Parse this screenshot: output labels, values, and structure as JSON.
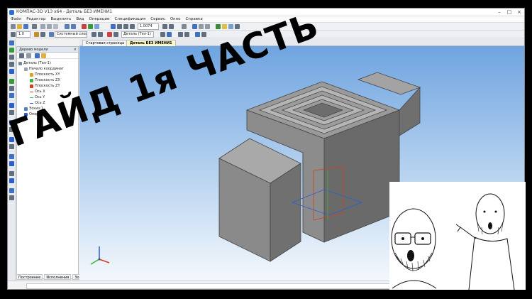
{
  "window": {
    "title": "КОМПАС-3D V13 x64 - Деталь БЕЗ ИМЕНИ1"
  },
  "menu": [
    "Файл",
    "Редактор",
    "Выделить",
    "Вид",
    "Операции",
    "Спецификация",
    "Сервис",
    "Окно",
    "Справка"
  ],
  "toolbar": {
    "scale_value": "1.0074",
    "step_value": "1.0",
    "layer_value": "Системный слой (0)",
    "part_value": "Деталь (Тел-1)"
  },
  "tree": {
    "header": "Дерево модели",
    "items": [
      {
        "label": "Деталь (Тел-1)",
        "color": "#7a8894"
      },
      {
        "label": "Начало координат",
        "color": "#9aa3ad"
      },
      {
        "label": "Плоскость XY",
        "color": "#e0a020"
      },
      {
        "label": "Плоскость ZX",
        "color": "#3fae3f"
      },
      {
        "label": "Плоскость ZY",
        "color": "#d04020"
      },
      {
        "label": "Ось X",
        "color": "#d04020"
      },
      {
        "label": "Ось Y",
        "color": "#3fae3f"
      },
      {
        "label": "Ось Z",
        "color": "#2a5fd0"
      },
      {
        "label": "Эскиз:1",
        "color": "#5080c0"
      },
      {
        "label": "Опер",
        "color": "#2a5fd0"
      }
    ],
    "tabs": [
      "Построение",
      "Исполнения",
      "Зоны"
    ]
  },
  "doc_tabs": {
    "start": "Стартовая страница",
    "active": "Деталь БЕЗ ИМЕНИ1"
  },
  "overlay": {
    "title": "ГАЙД 1я ЧАСТЬ"
  },
  "colors": {
    "viewport_top": "#6fa4e0",
    "viewport_bottom": "#f4f8fc",
    "model_gray": "#8c8c8c"
  }
}
